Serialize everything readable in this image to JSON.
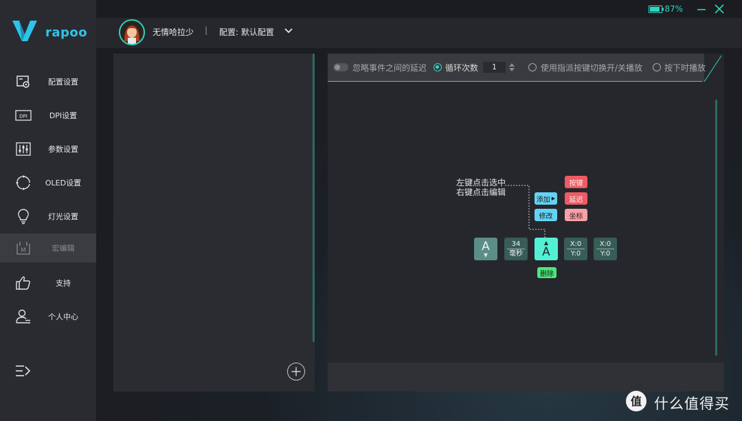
{
  "app": {
    "brand": "rapoo"
  },
  "titlebar": {
    "battery_pct": "87%"
  },
  "header": {
    "username": "无情哈拉少",
    "separator": "|",
    "profile_label": "配置: 默认配置"
  },
  "sidebar": {
    "items": [
      {
        "label": "配置设置",
        "icon": "config-icon"
      },
      {
        "label": "DPI设置",
        "icon": "dpi-icon"
      },
      {
        "label": "参数设置",
        "icon": "sliders-icon"
      },
      {
        "label": "OLED设置",
        "icon": "oled-icon"
      },
      {
        "label": "灯光设置",
        "icon": "bulb-icon"
      },
      {
        "label": "宏编辑",
        "icon": "macro-icon",
        "active": true
      },
      {
        "label": "支持",
        "icon": "thumbs-up-icon"
      },
      {
        "label": "个人中心",
        "icon": "user-icon"
      }
    ]
  },
  "toolbar": {
    "ignore_delay": "忽略事件之间的延迟",
    "loop_count": "循环次数",
    "loop_value": "1",
    "toggle_play": "使用指派按键切换开/关播放",
    "hold_play": "按下时播放"
  },
  "demo": {
    "hint_line1": "左键点击选中",
    "hint_line2": "右键点击编辑",
    "add": "添加",
    "modify": "修改",
    "key": "按键",
    "delay": "延迟",
    "coord": "坐标",
    "delete": "删除",
    "key_event": "A",
    "delay_value": "34",
    "delay_unit": "毫秒",
    "selected_key": "A",
    "x1": "X:0",
    "y1": "Y:0",
    "x2": "X:0",
    "y2": "Y:0"
  },
  "watermark": {
    "text": "什么值得买"
  },
  "colors": {
    "accent": "#2ed6c0",
    "brand": "#2ec4ea",
    "danger": "#f05b63",
    "success": "#4be87a"
  }
}
